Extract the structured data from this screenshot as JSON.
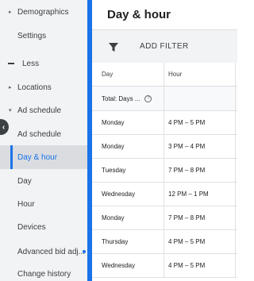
{
  "sidebar": {
    "items": [
      {
        "label": "Demographics",
        "caret": "▸"
      },
      {
        "label": "Settings"
      },
      {
        "label": "Less"
      },
      {
        "label": "Locations",
        "caret": "▸"
      },
      {
        "label": "Ad schedule",
        "caret": "▾"
      },
      {
        "label": "Ad schedule"
      },
      {
        "label": "Day & hour"
      },
      {
        "label": "Day"
      },
      {
        "label": "Hour"
      },
      {
        "label": "Devices"
      },
      {
        "label": "Advanced bid adj..."
      },
      {
        "label": "Change history"
      }
    ]
  },
  "main": {
    "title": "Day & hour",
    "filter": {
      "label": "ADD FILTER"
    },
    "table": {
      "headers": [
        "Day",
        "Hour"
      ],
      "total_label": "Total: Days ...",
      "rows": [
        {
          "day": "Monday",
          "hour": "4 PM – 5 PM"
        },
        {
          "day": "Monday",
          "hour": "3 PM – 4 PM"
        },
        {
          "day": "Tuesday",
          "hour": "7 PM – 8 PM"
        },
        {
          "day": "Wednesday",
          "hour": "12 PM – 1 PM"
        },
        {
          "day": "Monday",
          "hour": "7 PM – 8 PM"
        },
        {
          "day": "Thursday",
          "hour": "4 PM – 5 PM"
        },
        {
          "day": "Wednesday",
          "hour": "4 PM – 5 PM"
        }
      ]
    }
  },
  "colors": {
    "accent": "#1a73e8",
    "sidebar_bg": "#f1f3f4"
  },
  "icons": {
    "filter": "filter-icon",
    "help": "help-circle-icon",
    "collapse": "chevron-left-icon"
  }
}
